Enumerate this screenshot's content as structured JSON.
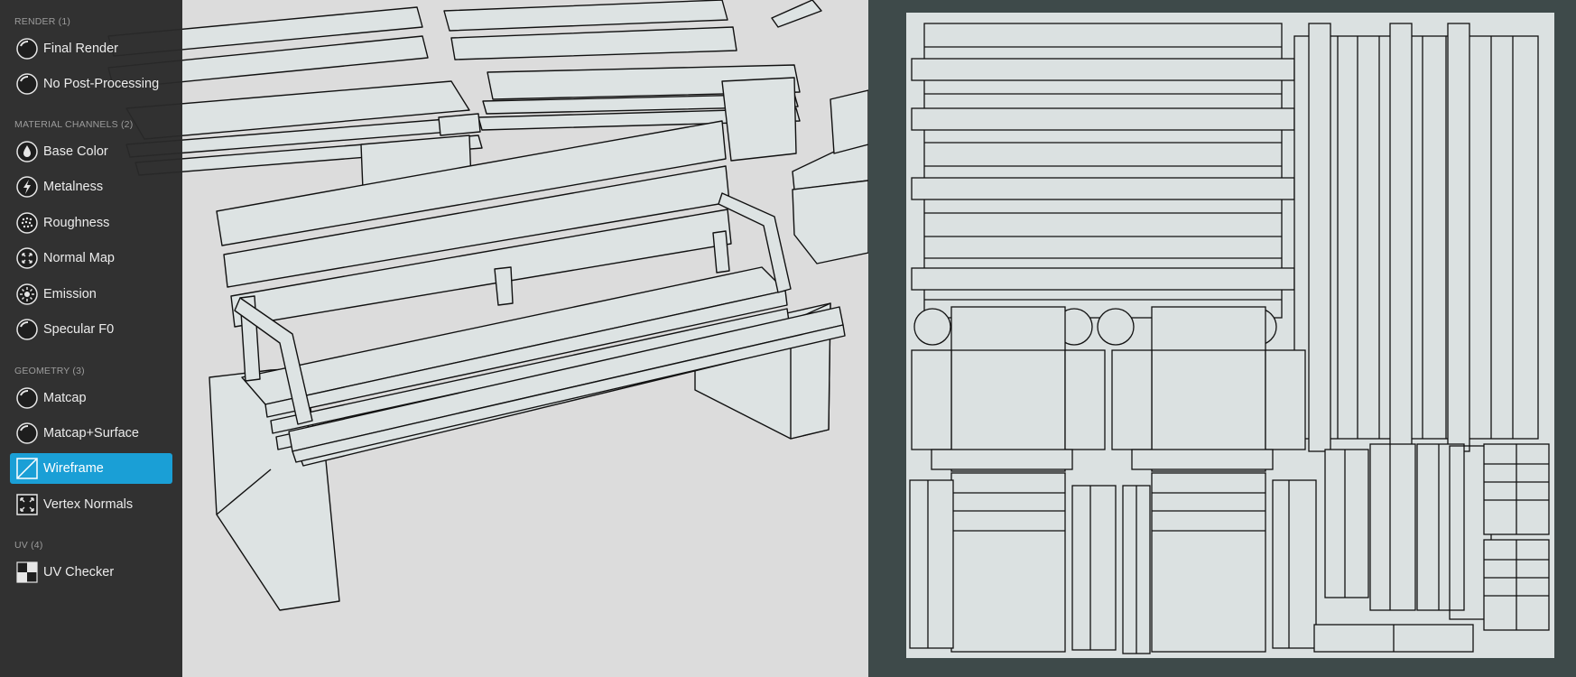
{
  "sidebar": {
    "sections": [
      {
        "header": "RENDER (1)",
        "items": [
          {
            "label": "Final Render",
            "icon": "sphere-icon"
          },
          {
            "label": "No Post-Processing",
            "icon": "sphere-icon"
          }
        ]
      },
      {
        "header": "MATERIAL CHANNELS (2)",
        "items": [
          {
            "label": "Base Color",
            "icon": "drop-icon"
          },
          {
            "label": "Metalness",
            "icon": "bolt-icon"
          },
          {
            "label": "Roughness",
            "icon": "dotted-sphere-icon"
          },
          {
            "label": "Normal Map",
            "icon": "arrows-sphere-icon"
          },
          {
            "label": "Emission",
            "icon": "sun-icon"
          },
          {
            "label": "Specular F0",
            "icon": "sphere-icon"
          }
        ]
      },
      {
        "header": "GEOMETRY (3)",
        "items": [
          {
            "label": "Matcap",
            "icon": "sphere-icon"
          },
          {
            "label": "Matcap+Surface",
            "icon": "sphere-icon"
          },
          {
            "label": "Wireframe",
            "icon": "wireframe-icon",
            "active": true
          },
          {
            "label": "Vertex Normals",
            "icon": "vertex-normals-icon"
          }
        ]
      },
      {
        "header": "UV (4)",
        "items": [
          {
            "label": "UV Checker",
            "icon": "checker-icon"
          }
        ]
      }
    ]
  },
  "colors": {
    "sidebar_bg": "#2a2a2a",
    "active_accent": "#1a9fd6",
    "viewport_bg": "#dcdcdc",
    "uv_panel_bg": "#3e4a4a",
    "uv_sheet_bg": "#dbe1e1",
    "wire_stroke": "#111111"
  }
}
